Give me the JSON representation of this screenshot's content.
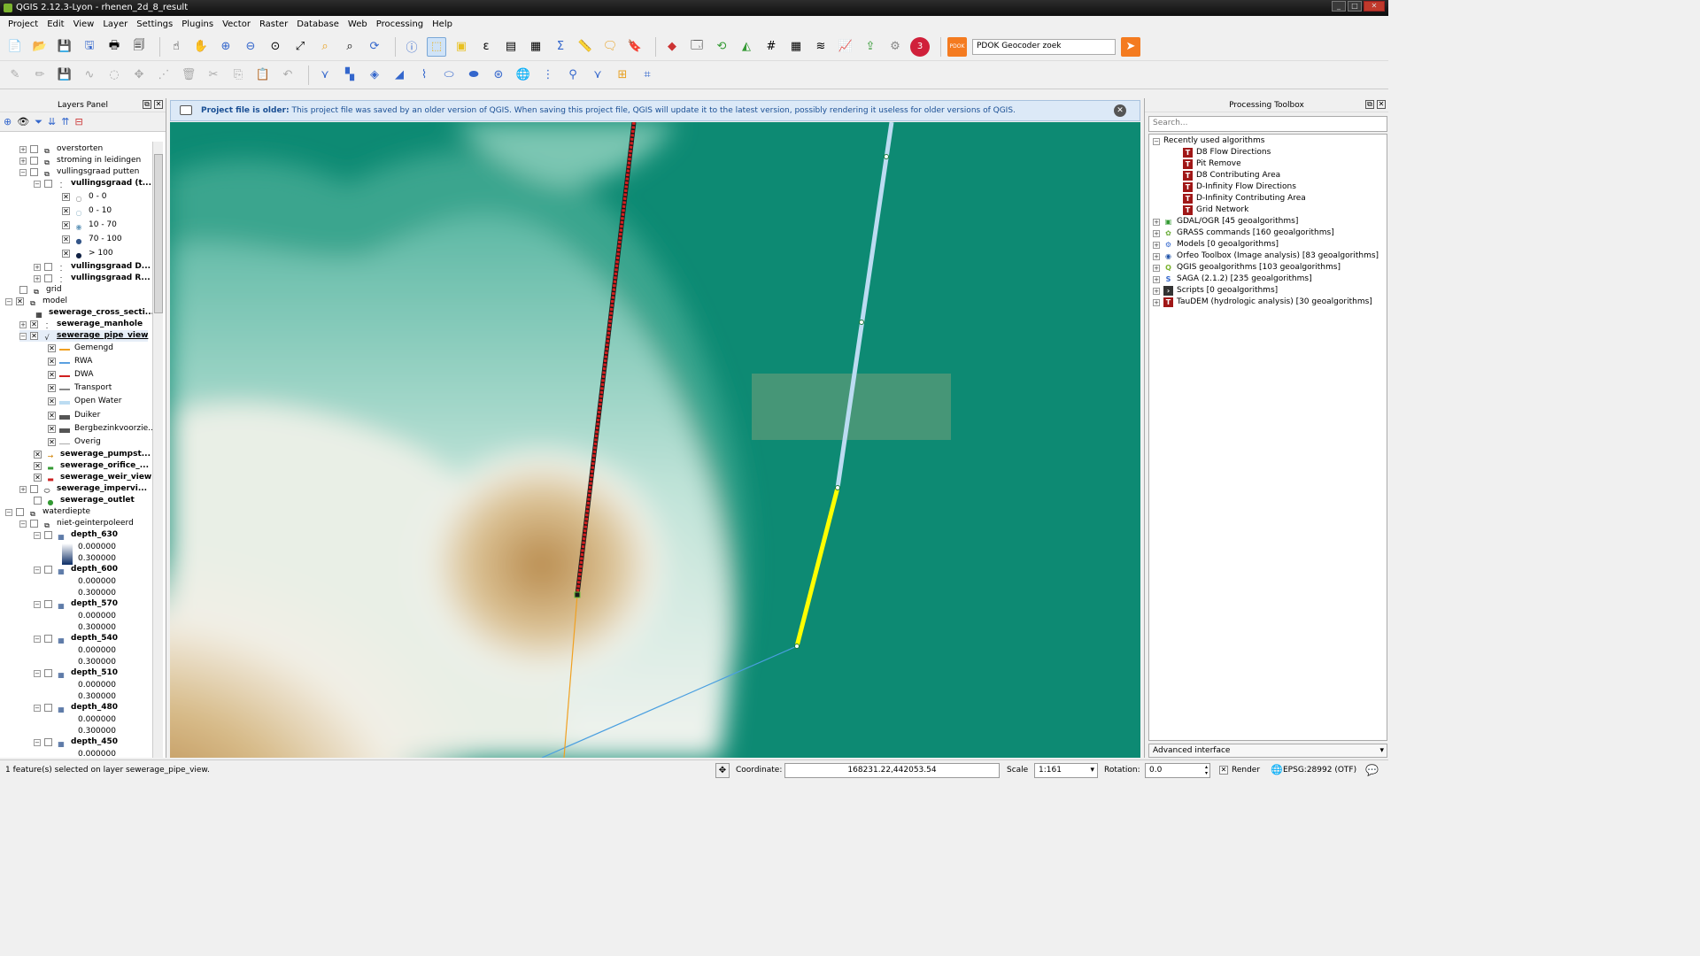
{
  "window": {
    "title": "QGIS 2.12.3-Lyon - rhenen_2d_8_result"
  },
  "menu": [
    "Project",
    "Edit",
    "View",
    "Layer",
    "Settings",
    "Plugins",
    "Vector",
    "Raster",
    "Database",
    "Web",
    "Processing",
    "Help"
  ],
  "toolbar": {
    "geocoder_placeholder": "PDOK Geocoder zoek",
    "pdok_label": "PDOK"
  },
  "layers_panel": {
    "title": "Layers Panel",
    "rows": [
      {
        "label": "overstorten",
        "bold": false
      },
      {
        "label": "stroming in leidingen",
        "bold": false
      },
      {
        "label": "vullingsgraad putten",
        "bold": false
      },
      {
        "label": "vullingsgraad (t...",
        "bold": true
      },
      {
        "label": "0 - 0",
        "bold": false
      },
      {
        "label": "0 - 10",
        "bold": false
      },
      {
        "label": "10 - 70",
        "bold": false
      },
      {
        "label": "70 - 100",
        "bold": false
      },
      {
        "label": "> 100",
        "bold": false
      },
      {
        "label": "vullingsgraad D...",
        "bold": true
      },
      {
        "label": "vullingsgraad R...",
        "bold": true
      },
      {
        "label": "grid",
        "bold": false
      },
      {
        "label": "model",
        "bold": false
      },
      {
        "label": "sewerage_cross_secti...",
        "bold": true
      },
      {
        "label": "sewerage_manhole",
        "bold": true
      },
      {
        "label": "sewerage_pipe_view",
        "bold": true
      },
      {
        "label": "Gemengd",
        "bold": false
      },
      {
        "label": "RWA",
        "bold": false
      },
      {
        "label": "DWA",
        "bold": false
      },
      {
        "label": "Transport",
        "bold": false
      },
      {
        "label": "Open Water",
        "bold": false
      },
      {
        "label": "Duiker",
        "bold": false
      },
      {
        "label": "Bergbezinkvoorzie...",
        "bold": false
      },
      {
        "label": "Overig",
        "bold": false
      },
      {
        "label": "sewerage_pumpst...",
        "bold": true
      },
      {
        "label": "sewerage_orifice_...",
        "bold": true
      },
      {
        "label": "sewerage_weir_view",
        "bold": true
      },
      {
        "label": "sewerage_impervi...",
        "bold": true
      },
      {
        "label": "sewerage_outlet",
        "bold": true
      },
      {
        "label": "waterdiepte",
        "bold": false
      },
      {
        "label": "niet-geinterpoleerd",
        "bold": false
      },
      {
        "label": "depth_630",
        "bold": true
      },
      {
        "label": "0.000000",
        "bold": false
      },
      {
        "label": "0.300000",
        "bold": false
      },
      {
        "label": "depth_600",
        "bold": true
      },
      {
        "label": "0.000000",
        "bold": false
      },
      {
        "label": "0.300000",
        "bold": false
      },
      {
        "label": "depth_570",
        "bold": true
      },
      {
        "label": "0.000000",
        "bold": false
      },
      {
        "label": "0.300000",
        "bold": false
      },
      {
        "label": "depth_540",
        "bold": true
      },
      {
        "label": "0.000000",
        "bold": false
      },
      {
        "label": "0.300000",
        "bold": false
      },
      {
        "label": "depth_510",
        "bold": true
      },
      {
        "label": "0.000000",
        "bold": false
      },
      {
        "label": "0.300000",
        "bold": false
      },
      {
        "label": "depth_480",
        "bold": true
      },
      {
        "label": "0.000000",
        "bold": false
      },
      {
        "label": "0.300000",
        "bold": false
      },
      {
        "label": "depth_450",
        "bold": true
      },
      {
        "label": "0.000000",
        "bold": false
      }
    ]
  },
  "message": {
    "title": "Project file is older:",
    "text": "This project file was saved by an older version of QGIS. When saving this project file, QGIS will update it to the latest version, possibly rendering it useless for older versions of QGIS."
  },
  "processing": {
    "title": "Processing Toolbox",
    "search_placeholder": "Search...",
    "recent_label": "Recently used algorithms",
    "recent": [
      "D8 Flow Directions",
      "Pit Remove",
      "D8 Contributing Area",
      "D-Infinity Flow Directions",
      "D-Infinity Contributing Area",
      "Grid Network"
    ],
    "providers": [
      "GDAL/OGR [45 geoalgorithms]",
      "GRASS commands [160 geoalgorithms]",
      "Models [0 geoalgorithms]",
      "Orfeo Toolbox (Image analysis) [83 geoalgorithms]",
      "QGIS geoalgorithms [103 geoalgorithms]",
      "SAGA (2.1.2) [235 geoalgorithms]",
      "Scripts [0 geoalgorithms]",
      "TauDEM (hydrologic analysis) [30 geoalgorithms]"
    ],
    "mode": "Advanced interface"
  },
  "status": {
    "message": "1 feature(s) selected on layer sewerage_pipe_view.",
    "coordinate_label": "Coordinate:",
    "coordinate": "168231.22,442053.54",
    "scale_label": "Scale",
    "scale": "1:161",
    "rotation_label": "Rotation:",
    "rotation": "0.0",
    "render_label": "Render",
    "crs": "EPSG:28992 (OTF)"
  },
  "colors": {
    "map_bg": "#0d8a73",
    "message_bg": "#dce9f7",
    "selected_pipe": "#ffff00",
    "manhole": "#cc1a1a"
  }
}
